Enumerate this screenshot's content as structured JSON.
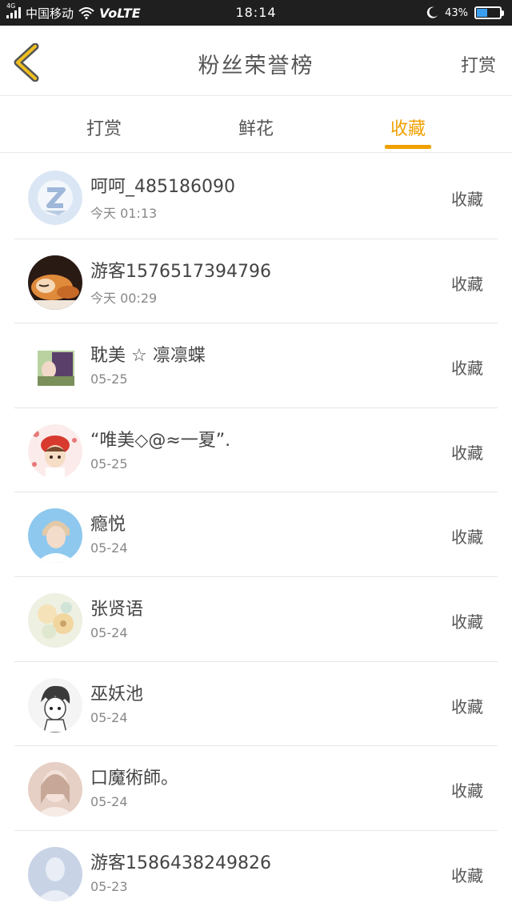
{
  "status_bar": {
    "network_tag": "4G",
    "carrier": "中国移动",
    "volte": "VoLTE",
    "time": "18:14",
    "battery_percent": "43%",
    "battery_level": 0.43
  },
  "header": {
    "title": "粉丝荣誉榜",
    "action_label": "打赏"
  },
  "tabs": [
    {
      "label": "打赏",
      "active": false
    },
    {
      "label": "鲜花",
      "active": false
    },
    {
      "label": "收藏",
      "active": true
    }
  ],
  "colors": {
    "accent": "#f0a000",
    "divider": "#e6e6e6"
  },
  "list": [
    {
      "name": "呵呵_485186090",
      "time": "今天 01:13",
      "kind": "收藏",
      "avatar": "default-qq-icon"
    },
    {
      "name": "游客1576517394796",
      "time": "今天 00:29",
      "kind": "收藏",
      "avatar": "sleeping-cat-photo"
    },
    {
      "name": "耽美 ☆ 凛凛蝶",
      "time": "05-25",
      "kind": "收藏",
      "avatar": "anime-girl-photo"
    },
    {
      "name": "“唯美◇@≈一夏”.",
      "time": "05-25",
      "kind": "收藏",
      "avatar": "red-hat-doll-photo"
    },
    {
      "name": "瘾悦",
      "time": "05-24",
      "kind": "收藏",
      "avatar": "portrait-photo"
    },
    {
      "name": "张贤语",
      "time": "05-24",
      "kind": "收藏",
      "avatar": "flowers-photo"
    },
    {
      "name": "巫妖池",
      "time": "05-24",
      "kind": "收藏",
      "avatar": "manga-sketch-photo"
    },
    {
      "name": "口魔術師。",
      "time": "05-24",
      "kind": "收藏",
      "avatar": "blurred-portrait-photo"
    },
    {
      "name": "游客1586438249826",
      "time": "05-23",
      "kind": "收藏",
      "avatar": "default-person-icon"
    }
  ]
}
